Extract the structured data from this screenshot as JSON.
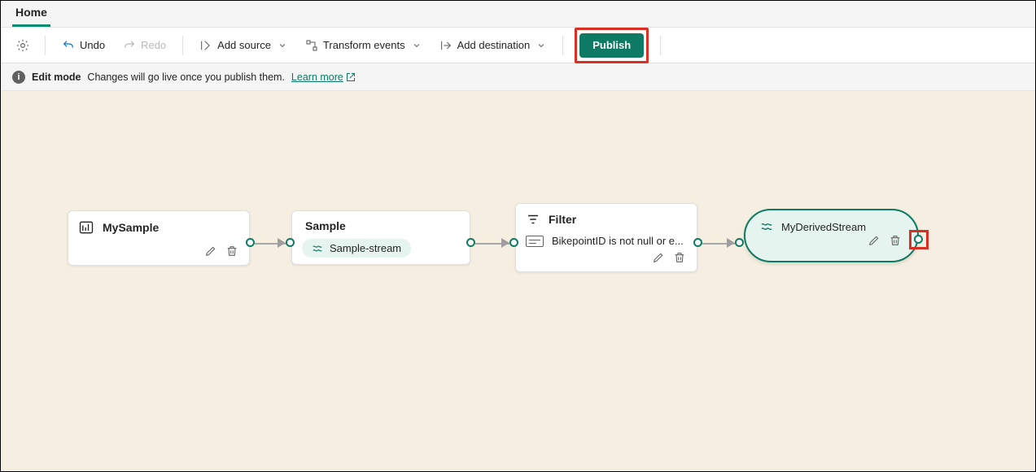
{
  "tabs": {
    "home": "Home"
  },
  "toolbar": {
    "undo": "Undo",
    "redo": "Redo",
    "add_source": "Add source",
    "transform": "Transform events",
    "add_dest": "Add destination",
    "publish": "Publish"
  },
  "infobar": {
    "mode": "Edit mode",
    "msg": "Changes will go live once you publish them.",
    "learn": "Learn more"
  },
  "nodes": {
    "source": {
      "title": "MySample"
    },
    "sample": {
      "title": "Sample",
      "chip": "Sample-stream"
    },
    "filter": {
      "title": "Filter",
      "rule": "BikepointID is not null or e..."
    },
    "dest": {
      "title": "MyDerivedStream"
    }
  }
}
